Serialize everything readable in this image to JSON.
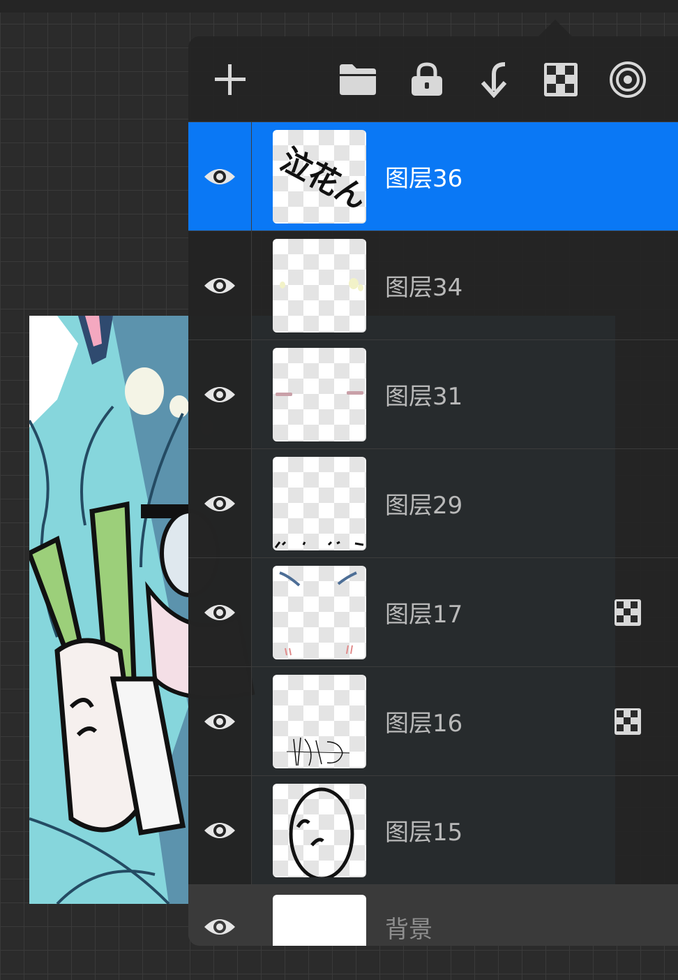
{
  "toolbar": {
    "add_icon": "plus-icon",
    "group_icon": "folder-icon",
    "lock_icon": "lock-icon",
    "merge_icon": "merge-down-icon",
    "alpha_icon": "checker-icon",
    "options_icon": "concentric-circles-icon"
  },
  "colors": {
    "selected_row": "#0a78f5",
    "panel_bg": "#242424",
    "canvas_bg": "#2b2b2b",
    "text": "#b9b9b9"
  },
  "layers": [
    {
      "name": "图层36",
      "visible": true,
      "selected": true,
      "mask": false,
      "thumb_text": "泣花ん"
    },
    {
      "name": "图层34",
      "visible": true,
      "selected": false,
      "mask": false
    },
    {
      "name": "图层31",
      "visible": true,
      "selected": false,
      "mask": false
    },
    {
      "name": "图层29",
      "visible": true,
      "selected": false,
      "mask": false
    },
    {
      "name": "图层17",
      "visible": true,
      "selected": false,
      "mask": true
    },
    {
      "name": "图层16",
      "visible": true,
      "selected": false,
      "mask": true
    },
    {
      "name": "图层15",
      "visible": true,
      "selected": false,
      "mask": false
    }
  ],
  "background": {
    "name": "背景",
    "visible": true,
    "color": "#ffffff"
  }
}
